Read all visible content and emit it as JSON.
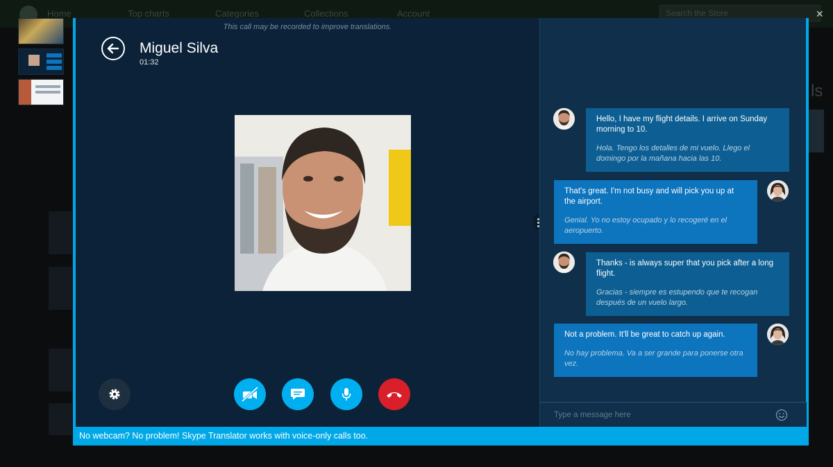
{
  "background": {
    "nav": [
      "Home",
      "Top charts",
      "Categories",
      "Collections",
      "Account"
    ],
    "search_placeholder": "Search the Store",
    "right_title": "ls"
  },
  "call": {
    "record_note": "This call may be recorded to improve translations.",
    "contact_name": "Miguel Silva",
    "timer": "01:32"
  },
  "controls": {
    "icons": [
      "gear-icon",
      "video-off-icon",
      "chat-icon",
      "microphone-icon",
      "hang-up-icon"
    ]
  },
  "messages": [
    {
      "from": "contact",
      "text": "Hello, I have my flight details. I arrive on Sunday morning to 10.",
      "translation": "Hola. Tengo los detalles de mi vuelo. Llego el domingo por la mañana hacia las 10."
    },
    {
      "from": "self",
      "text": "That's great. I'm not busy and will pick you up at the airport.",
      "translation": "Genial. Yo no estoy ocupado y lo recogeré en el aeropuerto."
    },
    {
      "from": "contact",
      "text": "Thanks - is always super that you pick after a long flight.",
      "translation": "Gracias - siempre es estupendo que te recogan después de un vuelo largo."
    },
    {
      "from": "self",
      "text": "Not a problem. It'll be great to catch up again.",
      "translation": "No hay problema. Va a ser grande para ponerse otra vez."
    }
  ],
  "composer": {
    "placeholder": "Type a message here"
  },
  "footer": {
    "text": "No webcam? No problem! Skype Translator works with voice-only calls too."
  },
  "colors": {
    "accent": "#00a8e8",
    "call_bg": "#0b2238",
    "chat_bg": "#0f2f4a",
    "end_call": "#d81f2a"
  }
}
